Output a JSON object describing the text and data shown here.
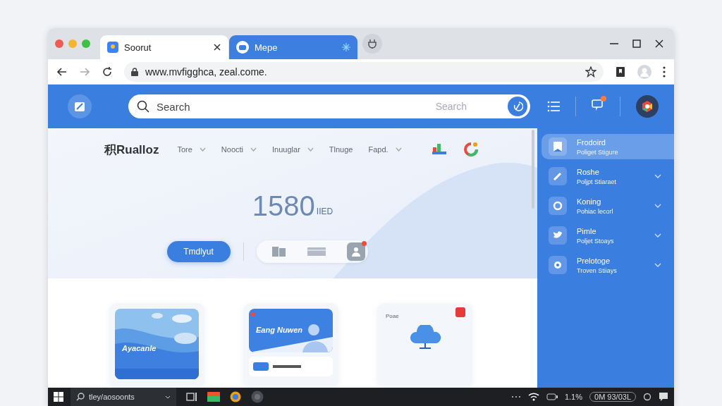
{
  "browser": {
    "tabs": [
      {
        "label": "Soorut",
        "selected": true
      },
      {
        "label": "Mepe",
        "selected": false
      }
    ],
    "url": "www.mvfigghca, zeal.come."
  },
  "header": {
    "search_placeholder": "Search",
    "search_hint": "Search"
  },
  "nav": {
    "brand": "积Rualloz",
    "items": [
      {
        "label": "Tore",
        "dropdown": true
      },
      {
        "label": "Noocti",
        "dropdown": true
      },
      {
        "label": "Inuuglar",
        "dropdown": true
      },
      {
        "label": "Tlnuge",
        "dropdown": false
      },
      {
        "label": "Fapd.",
        "dropdown": true
      }
    ]
  },
  "hero": {
    "value": "1580",
    "unit": "IIED",
    "button": "Tmdlyut"
  },
  "sidebar": {
    "items": [
      {
        "title": "Frodoird",
        "subtitle": "Poliget Stigure",
        "selected": true,
        "has_submenu": false
      },
      {
        "title": "Roshe",
        "subtitle": "Poljpt Stiaraet",
        "selected": false,
        "has_submenu": true
      },
      {
        "title": "Koning",
        "subtitle": "Pohiac lecorl",
        "selected": false,
        "has_submenu": true
      },
      {
        "title": "Pimle",
        "subtitle": "Poljet Stoays",
        "selected": false,
        "has_submenu": true
      },
      {
        "title": "Prelotoge",
        "subtitle": "Troven Stiiays",
        "selected": false,
        "has_submenu": true
      }
    ]
  },
  "cards": [
    {
      "kind": "landscape",
      "title": "Ayacanle"
    },
    {
      "kind": "banner",
      "title": "Eang Nuwen"
    },
    {
      "kind": "cloud",
      "title": "Poae"
    }
  ],
  "taskbar": {
    "search": "tley/aosoonts",
    "battery": "1.1%",
    "clock": "0M 93/03L"
  }
}
